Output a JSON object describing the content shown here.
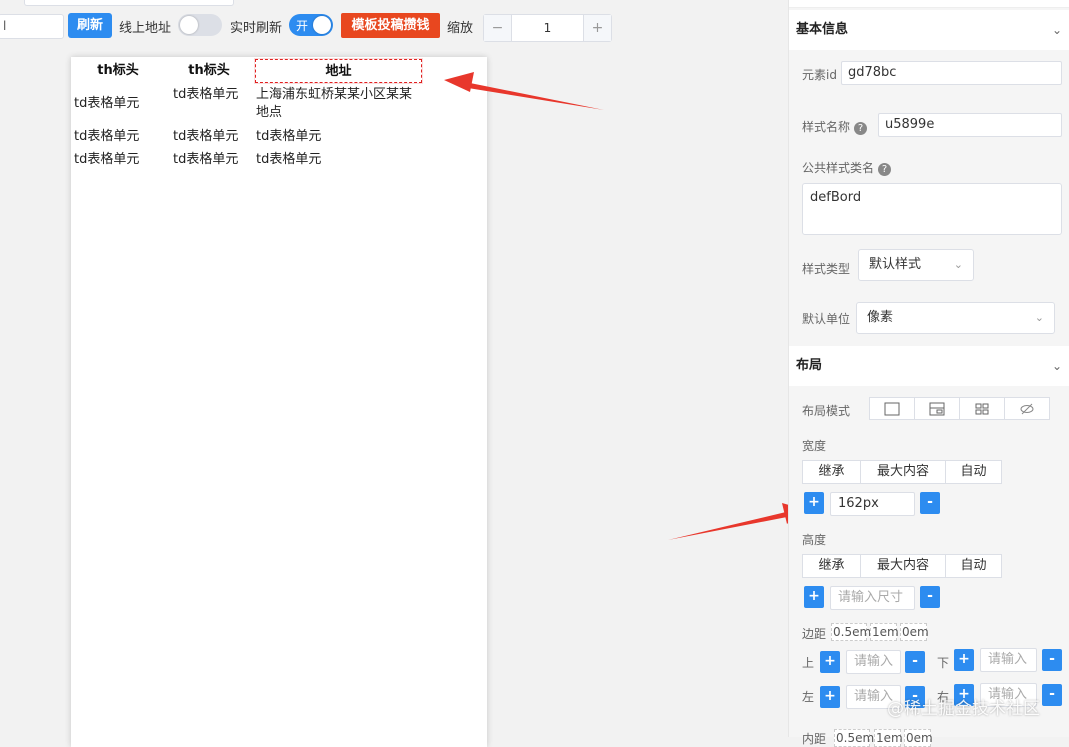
{
  "toolbar": {
    "url_value": "l",
    "refresh_label": "刷新",
    "online_label": "线上地址",
    "realtime_label": "实时刷新",
    "switch_on_text": "开",
    "template_label": "模板投稿攒钱",
    "zoom_label": "缩放",
    "zoom_minus": "−",
    "zoom_value": "1",
    "zoom_plus": "+"
  },
  "table": {
    "headers": [
      "th标头",
      "th标头",
      "地址"
    ],
    "rows": [
      [
        "td表格单元",
        "td表格单元",
        "上海浦东虹桥某某小区某某地点"
      ],
      [
        "td表格单元",
        "td表格单元",
        "td表格单元"
      ],
      [
        "td表格单元",
        "td表格单元",
        "td表格单元"
      ]
    ]
  },
  "panel": {
    "basic": {
      "title": "基本信息",
      "element_id_label": "元素id",
      "element_id_value": "gd78bc",
      "style_name_label": "样式名称",
      "style_name_value": "u5899e",
      "public_class_label": "公共样式类名",
      "public_class_value": "defBord",
      "style_type_label": "样式类型",
      "style_type_value": "默认样式",
      "unit_label": "默认单位",
      "unit_value": "像素",
      "help_icon": "?"
    },
    "layout": {
      "title": "布局",
      "mode_label": "布局模式",
      "width_label": "宽度",
      "height_label": "高度",
      "options": [
        "继承",
        "最大内容",
        "自动"
      ],
      "width_value": "162px",
      "size_placeholder": "请输入尺寸",
      "plus": "+",
      "minus": "-",
      "margin_label": "边距",
      "margin_presets": [
        "0.5em",
        "1em",
        "0em"
      ],
      "top_label": "上",
      "bottom_label": "下",
      "left_label": "左",
      "right_label": "右",
      "input_placeholder": "请输入",
      "padding_label": "内距",
      "padding_presets": [
        "0.5em",
        "1em",
        "0em"
      ]
    }
  },
  "watermark": "@稀土掘金技术社区",
  "colors": {
    "primary": "#2d8cf0",
    "danger": "#e8471f",
    "arrow": "#e8372c"
  }
}
